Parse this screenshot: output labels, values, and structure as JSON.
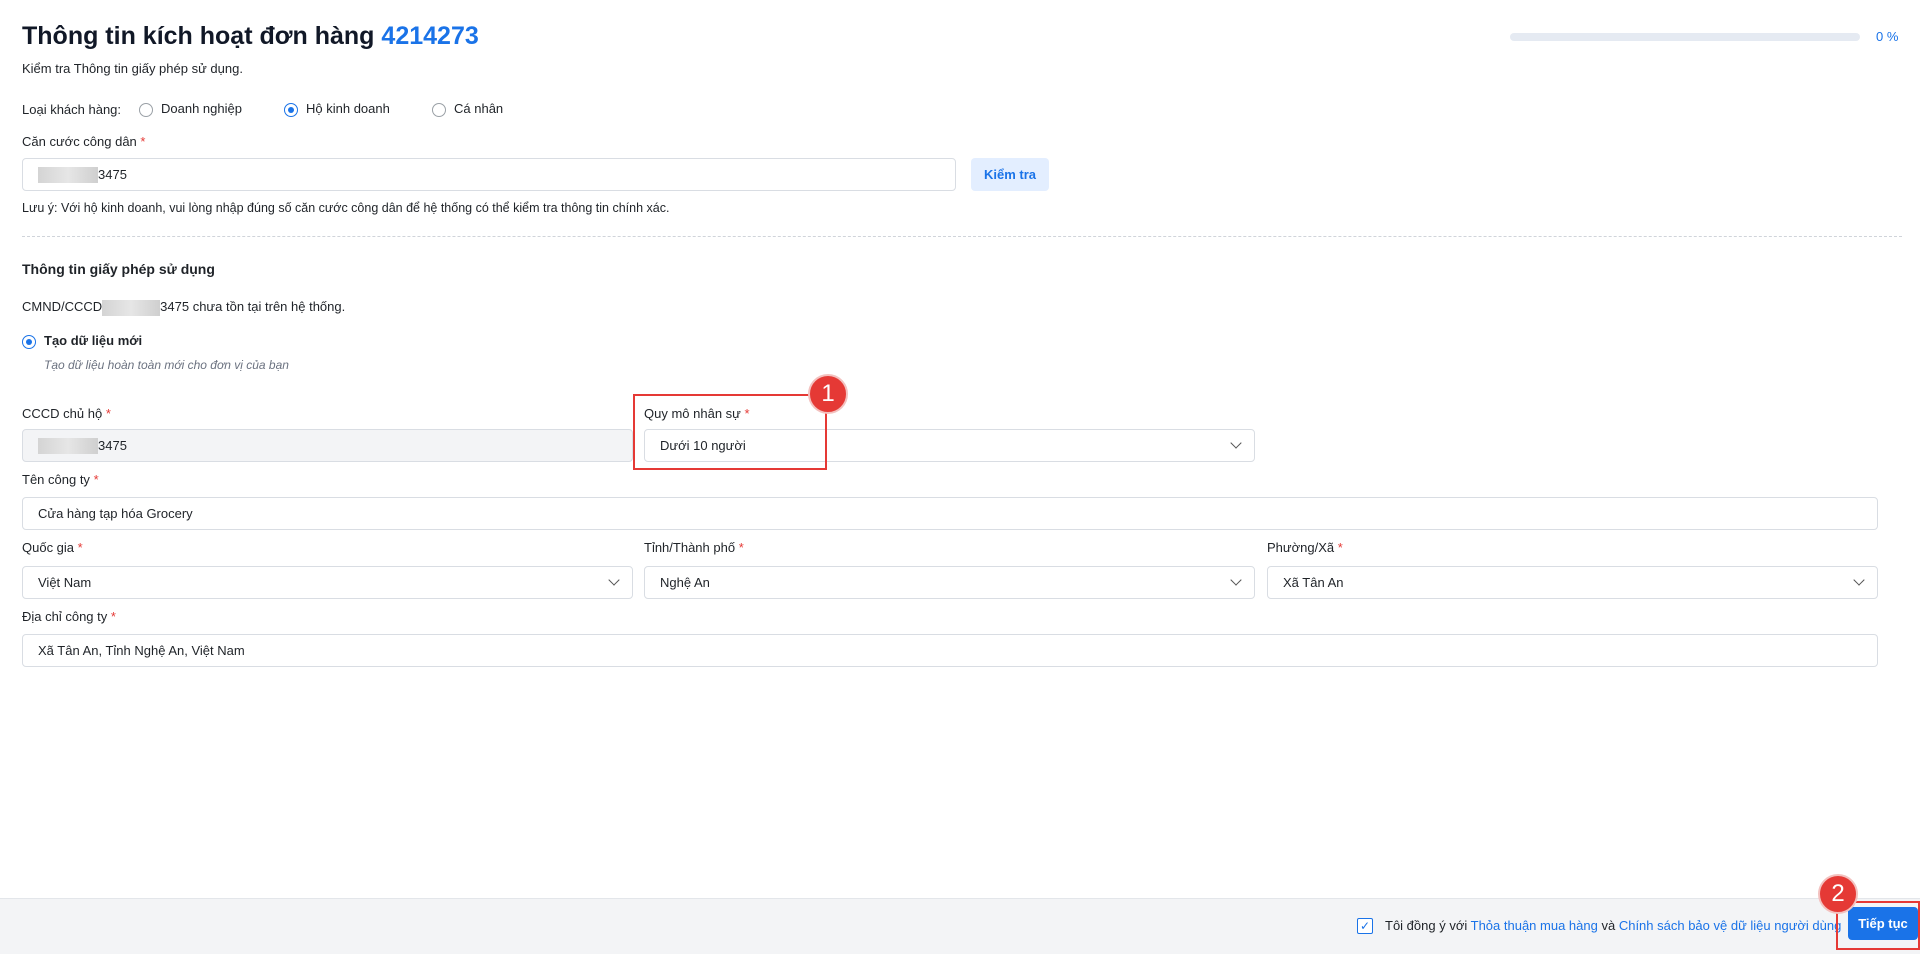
{
  "header": {
    "title": "Thông tin kích hoạt đơn hàng",
    "order_number": "4214273",
    "subtitle": "Kiểm tra Thông tin giấy phép sử dụng.",
    "progress_percent": 0,
    "progress_label": "0 %"
  },
  "customer_type": {
    "label": "Loại khách hàng:",
    "options": [
      "Doanh nghiệp",
      "Hộ kinh doanh",
      "Cá nhân"
    ],
    "selected": "Hộ kinh doanh"
  },
  "id_field": {
    "label": "Căn cước công dân",
    "required": "*",
    "value_suffix": "3475",
    "check_button": "Kiểm tra"
  },
  "note": "Lưu ý: Với hộ kinh doanh, vui lòng nhập đúng số căn cước công dân để hệ thống có thể kiểm tra thông tin chính xác.",
  "license": {
    "heading": "Thông tin giấy phép sử dụng",
    "status_prefix": "CMND/CCCD",
    "status_suffix": "3475 chưa tồn tại trên hệ thống.",
    "option_label": "Tạo dữ liệu mới",
    "option_desc": "Tạo dữ liệu hoàn toàn mới cho đơn vị của bạn"
  },
  "form": {
    "owner_id": {
      "label": "CCCD chủ hộ",
      "value_suffix": "3475"
    },
    "staff_size": {
      "label": "Quy mô nhân sự",
      "value": "Dưới 10 người"
    },
    "company_name": {
      "label": "Tên công ty",
      "value": "Cửa hàng tạp hóa Grocery"
    },
    "country": {
      "label": "Quốc gia",
      "value": "Việt Nam"
    },
    "province": {
      "label": "Tỉnh/Thành phố",
      "value": "Nghệ An"
    },
    "ward": {
      "label": "Phường/Xã",
      "value": "Xã Tân An"
    },
    "address": {
      "label": "Địa chỉ công ty",
      "value": "Xã Tân An, Tỉnh Nghệ An, Việt Nam"
    }
  },
  "annotations": {
    "one": "1",
    "two": "2"
  },
  "footer": {
    "agree_prefix": "Tôi đồng ý với",
    "link1": "Thỏa thuận mua hàng",
    "and": "và",
    "link2": "Chính sách bảo vệ dữ liệu người dùng",
    "next_button": "Tiếp tục"
  },
  "colors": {
    "accent": "#1a73e8",
    "annotation": "#e53935"
  }
}
